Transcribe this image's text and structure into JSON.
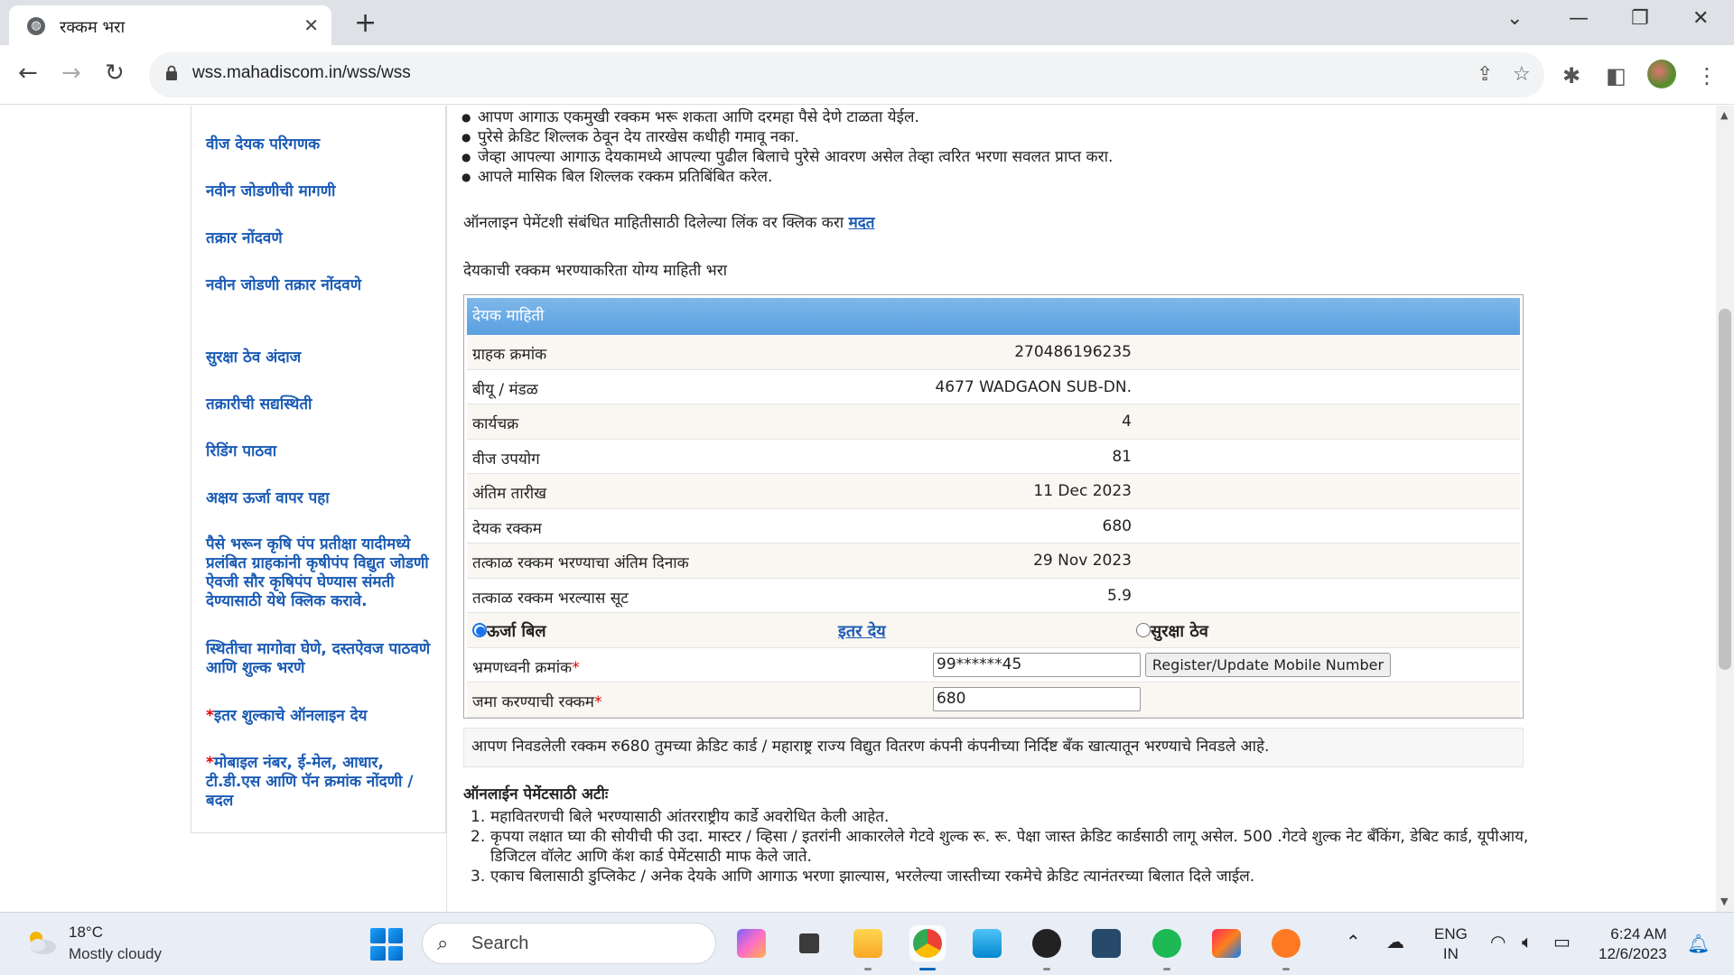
{
  "browser": {
    "tab_title": "रक्कम भरा",
    "tab_close": "✕",
    "new_tab": "+",
    "url": "wss.mahadiscom.in/wss/wss",
    "window_controls": {
      "dropdown": "⌄",
      "minimize": "—",
      "restore": "❐",
      "close": "✕"
    }
  },
  "sidebar": {
    "items": [
      "वीज देयक परिगणक",
      "नवीन जोडणीची मागणी",
      "तक्रार नोंदवणे",
      "नवीन जोडणी तक्रार नोंदवणे",
      "सुरक्षा ठेव अंदाज",
      "तक्रारीची सद्यस्थिती",
      "रिडिंग पाठवा",
      "अक्षय ऊर्जा वापर पहा",
      "पैसे भरून कृषि पंप प्रतीक्षा यादीमध्ये प्रलंबित ग्राहकांनी कृषीपंप विद्युत जोडणी ऐवजी सौर कृषिपंप घेण्यास संमती देण्यासाठी येथे क्लिक करावे.",
      "स्थितीचा मागोवा घेणे, दस्तऐवज पाठवणे आणि शुल्क भरणे",
      "इतर शुल्काचे ऑनलाइन देय",
      "मोबाइल नंबर, ई-मेल, आधार, टी.डी.एस आणि पॅन क्रमांक नोंदणी / बदल"
    ],
    "star": "*"
  },
  "main": {
    "bullets": [
      "आपण आगाऊ एकमुखी रक्कम भरू शकता आणि दरमहा पैसे देणे टाळता येईल.",
      "पुरेसे क्रेडिट शिल्लक ठेवून देय तारखेस कधीही गमावू नका.",
      "जेव्हा आपल्या आगाऊ देयकामध्ये आपल्या पुढील बिलाचे पुरेसे आवरण असेल तेव्हा त्वरित भरणा सवलत प्राप्त करा.",
      "आपले मासिक बिल शिल्लक रक्कम प्रतिबिंबित करेल."
    ],
    "help_text": "ऑनलाइन पेमेंटशी संबंधित माहितीसाठी दिलेल्या लिंक वर क्लिक करा ",
    "help_link": "मदत",
    "fill_text": "देयकाची रक्कम भरण्याकरिता योग्य माहिती भरा",
    "bill_header": "देयक माहिती",
    "bill_rows": [
      {
        "label": "ग्राहक क्रमांक",
        "value": "270486196235"
      },
      {
        "label": "बीयू / मंडळ",
        "value": "4677 WADGAON SUB-DN."
      },
      {
        "label": "कार्यचक्र",
        "value": "4"
      },
      {
        "label": "वीज उपयोग",
        "value": "81"
      },
      {
        "label": "अंतिम तारीख",
        "value": "11 Dec 2023"
      },
      {
        "label": "देयक रक्कम",
        "value": "680"
      },
      {
        "label": "तत्काळ रक्कम भरण्याचा अंतिम दिनाक",
        "value": "29 Nov 2023"
      },
      {
        "label": "तत्काळ रक्कम भरल्यास सूट",
        "value": "5.9"
      }
    ],
    "radio_energy": "ऊर्जा बिल",
    "link_other": "इतर देय",
    "radio_security": "सुरक्षा ठेव",
    "mobile_label": "भ्रमणध्वनी क्रमांक",
    "mobile_value": "99******45",
    "register_btn": "Register/Update Mobile Number",
    "amount_label": "जमा करण्याची रक्कम",
    "amount_value": "680",
    "required_mark": "*",
    "notice": "आपण निवडलेली रक्कम रु680 तुमच्या क्रेडिट कार्ड / महाराष्ट्र राज्य विद्युत वितरण कंपनी कंपनीच्या निर्दिष्ट बँक खात्यातून भरण्याचे निवडले आहे.",
    "terms_title": "ऑनलाईन पेमेंटसाठी अटीः",
    "terms": [
      {
        "num": "1.",
        "text": "महावितरणची बिले भरण्यासाठी आंतरराष्ट्रीय कार्डे अवरोधित केली आहेत."
      },
      {
        "num": "2.",
        "text": "कृपया लक्षात घ्या की सोयीची फी उदा. मास्टर / व्हिसा / इतरांनी आकारलेले गेटवे शुल्क रू. रू. पेक्षा जास्त क्रेडिट कार्डसाठी लागू असेल. 500 .गेटवे शुल्क नेट बँकिंग, डेबिट कार्ड, यूपीआय, डिजिटल वॉलेट आणि कॅश कार्ड पेमेंटसाठी माफ केले जाते."
      },
      {
        "num": "3.",
        "text": "एकाच बिलासाठी डुप्लिकेट / अनेक देयके आणि आगाऊ भरणा झाल्यास, भरलेल्या जास्तीच्या रकमेचे क्रेडिट त्यानंतरच्या बिलात दिले जाईल."
      }
    ]
  },
  "taskbar": {
    "temperature": "18°C",
    "weather": "Mostly cloudy",
    "search": "Search",
    "lang_top": "ENG",
    "lang_bottom": "IN",
    "time": "6:24 AM",
    "date": "12/6/2023"
  },
  "colors": {
    "accent_blue": "#1a5bb5",
    "header_blue": "#5a9fe0",
    "required_red": "#dd0000"
  }
}
